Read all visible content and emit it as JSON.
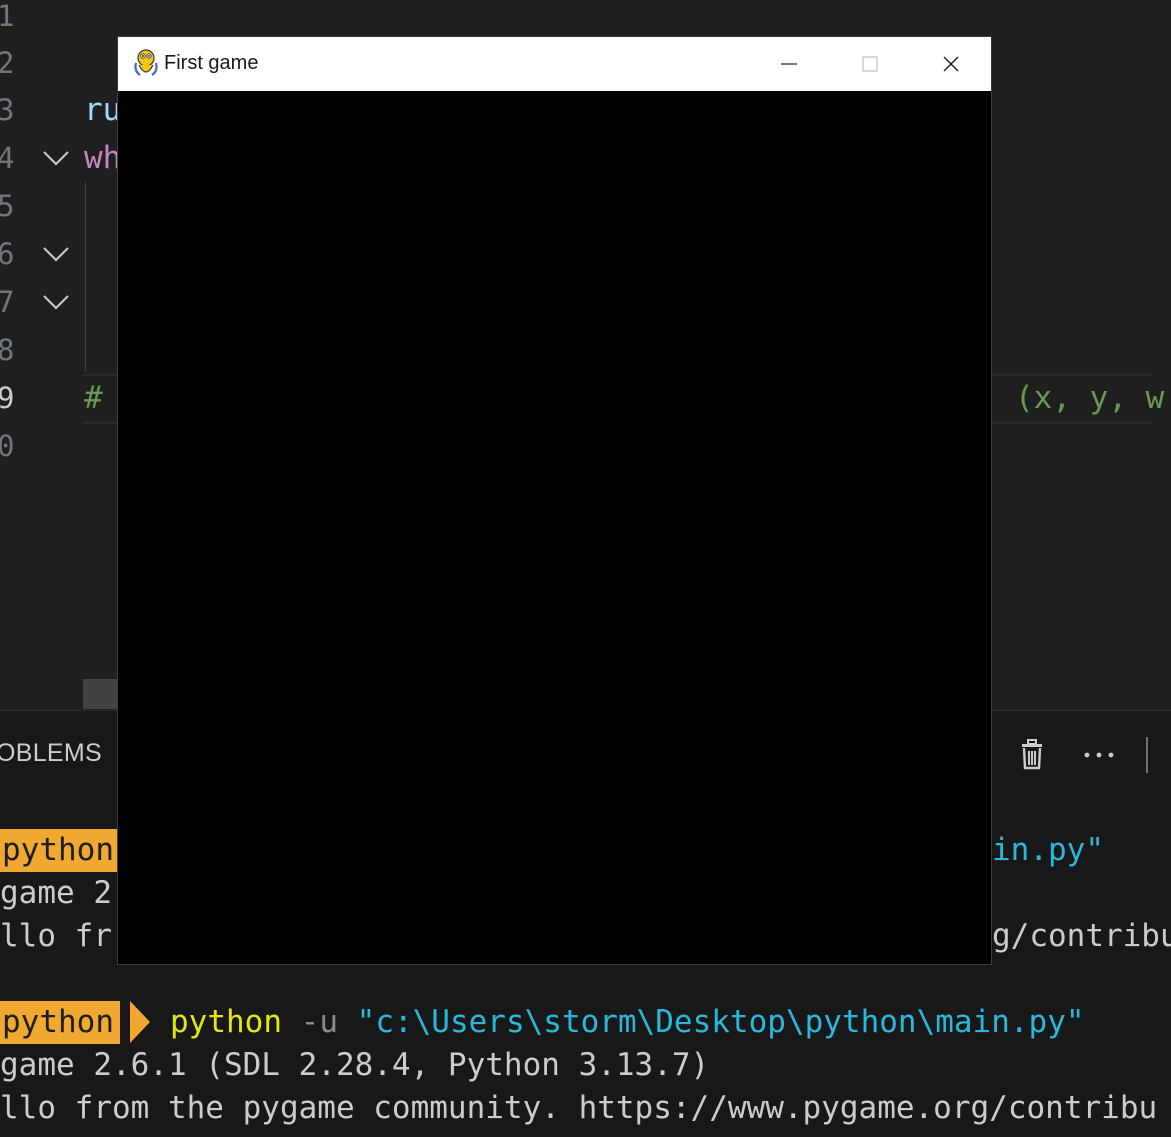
{
  "editor": {
    "line_numbers": [
      "1",
      "2",
      "3",
      "4",
      "5",
      "6",
      "7",
      "8",
      "9",
      "0"
    ],
    "active_line": "9",
    "code_fragments": {
      "line3": "ru",
      "line4": "wh",
      "line9_comment": "#",
      "line9_tail": "(x, y, w"
    }
  },
  "panel": {
    "tab_label": "OBLEMS",
    "icons": [
      "trash-icon",
      "more-actions-icon"
    ]
  },
  "terminal": {
    "run1": {
      "badge": "python",
      "cmd_tail": "in.py\"",
      "line2": "game 2",
      "line3_start": "llo fr",
      "line3_end": "g/contribu"
    },
    "run2": {
      "badge": "python",
      "cmd": "python",
      "flag": "-u",
      "path": "\"c:\\Users\\storm\\Desktop\\python\\main.py\"",
      "line2": "game 2.6.1 (SDL 2.28.4, Python 3.13.7)",
      "line3": "llo from the pygame community. https://www.pygame.org/contribu"
    }
  },
  "window": {
    "title": "First game",
    "icon": "pygame-snake-icon",
    "canvas_color": "#000000"
  },
  "colors": {
    "badge": "#f0a830",
    "keyword_var": "#9cdcfe",
    "keyword_control": "#c586c0",
    "comment": "#6a9955",
    "terminal_yellow": "#e5e510",
    "terminal_string": "#29b8db"
  }
}
